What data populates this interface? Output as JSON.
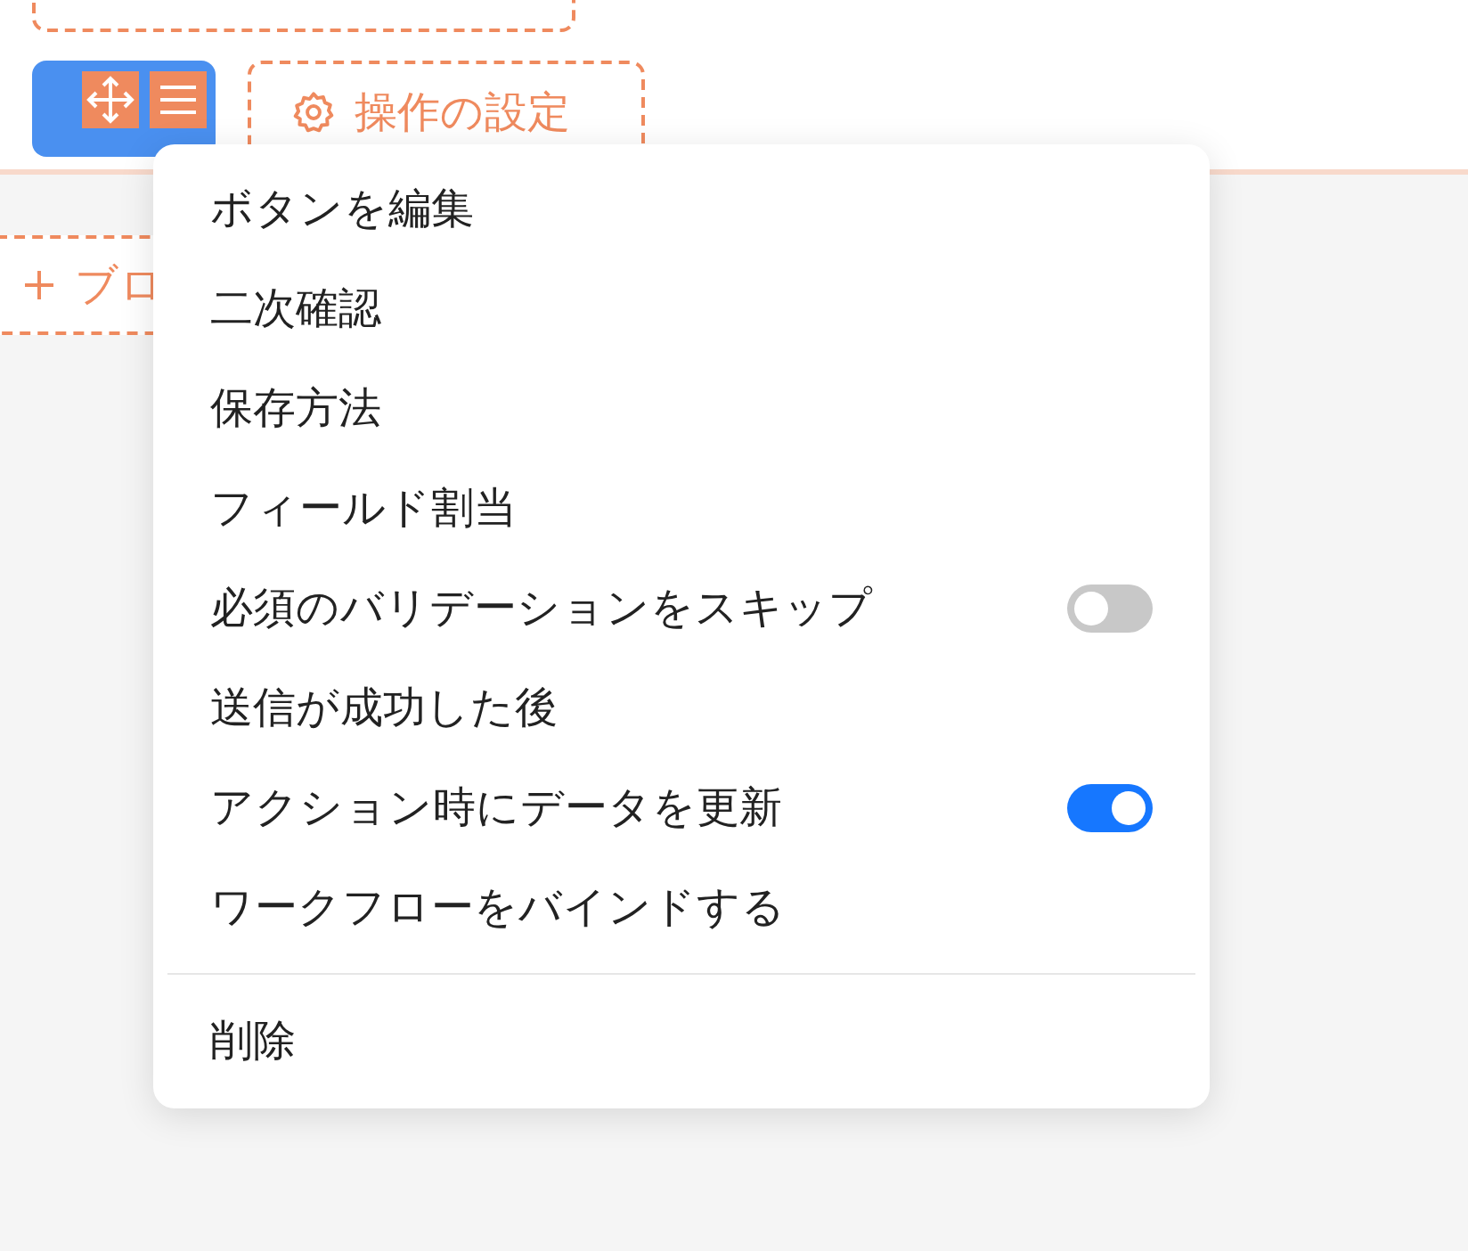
{
  "toolbar": {
    "action_button": {
      "label": "操作の設定"
    },
    "add_button": {
      "label": "ブロ"
    }
  },
  "menu": {
    "items": [
      {
        "kind": "plain",
        "label": "ボタンを編集"
      },
      {
        "kind": "plain",
        "label": "二次確認"
      },
      {
        "kind": "plain",
        "label": "保存方法"
      },
      {
        "kind": "plain",
        "label": "フィールド割当"
      },
      {
        "kind": "toggle",
        "label": "必須のバリデーションをスキップ",
        "on": false
      },
      {
        "kind": "plain",
        "label": "送信が成功した後"
      },
      {
        "kind": "toggle",
        "label": "アクション時にデータを更新",
        "on": true
      },
      {
        "kind": "plain",
        "label": "ワークフローをバインドする"
      },
      {
        "kind": "divider"
      },
      {
        "kind": "plain",
        "label": "削除"
      }
    ]
  }
}
